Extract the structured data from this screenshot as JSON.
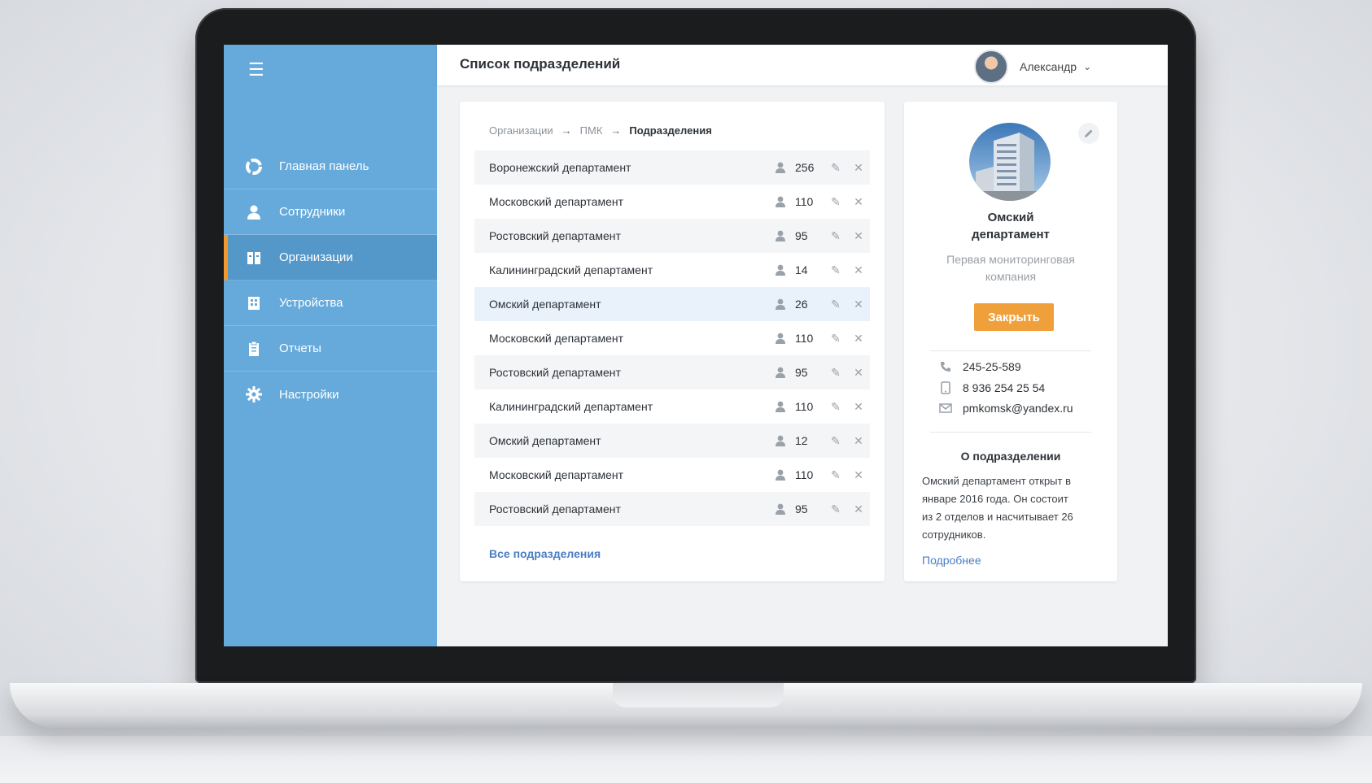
{
  "header": {
    "title": "Список подразделений",
    "user_name": "Александр"
  },
  "sidebar": {
    "items": [
      {
        "label": "Главная панель",
        "icon": "dashboard-icon"
      },
      {
        "label": "Сотрудники",
        "icon": "person-icon"
      },
      {
        "label": "Организации",
        "icon": "organization-icon",
        "active": true
      },
      {
        "label": "Устройства",
        "icon": "device-icon"
      },
      {
        "label": "Отчеты",
        "icon": "clipboard-icon"
      },
      {
        "label": "Настройки",
        "icon": "gear-icon"
      }
    ]
  },
  "breadcrumb": {
    "items": [
      "Организации",
      "ПМК",
      "Подразделения"
    ],
    "separator": "→"
  },
  "departments": [
    {
      "name": "Воронежский департамент",
      "count": "256"
    },
    {
      "name": "Московский департамент",
      "count": "110"
    },
    {
      "name": "Ростовский департамент",
      "count": "95"
    },
    {
      "name": "Калининградский департамент",
      "count": "14"
    },
    {
      "name": "Омский департамент",
      "count": "26",
      "selected": true
    },
    {
      "name": "Московский департамент",
      "count": "110"
    },
    {
      "name": "Ростовский департамент",
      "count": "95"
    },
    {
      "name": "Калининградский департамент",
      "count": "110"
    },
    {
      "name": "Омский департамент",
      "count": "12"
    },
    {
      "name": "Московский департамент",
      "count": "110"
    },
    {
      "name": "Ростовский департамент",
      "count": "95"
    }
  ],
  "list_link": "Все подразделения",
  "detail": {
    "title_line1": "Омский",
    "title_line2": "департамент",
    "subtitle_line1": "Первая мониторинговая",
    "subtitle_line2": "компания",
    "close_label": "Закрыть",
    "phone": "245-25-589",
    "mobile": "8 936 254 25 54",
    "email": "pmkomsk@yandex.ru",
    "about_title": "О подразделении",
    "about_lines": [
      "Омский департамент открыт в",
      "январе 2016 года. Он состоит",
      "из 2 отделов и насчитывает 26",
      "сотрудников."
    ],
    "more_link": "Подробнее"
  },
  "colors": {
    "sidebar": "#66aadb",
    "accent": "#f0a03a",
    "active_marker": "#ef9a2e",
    "link": "#4a7ec4"
  }
}
